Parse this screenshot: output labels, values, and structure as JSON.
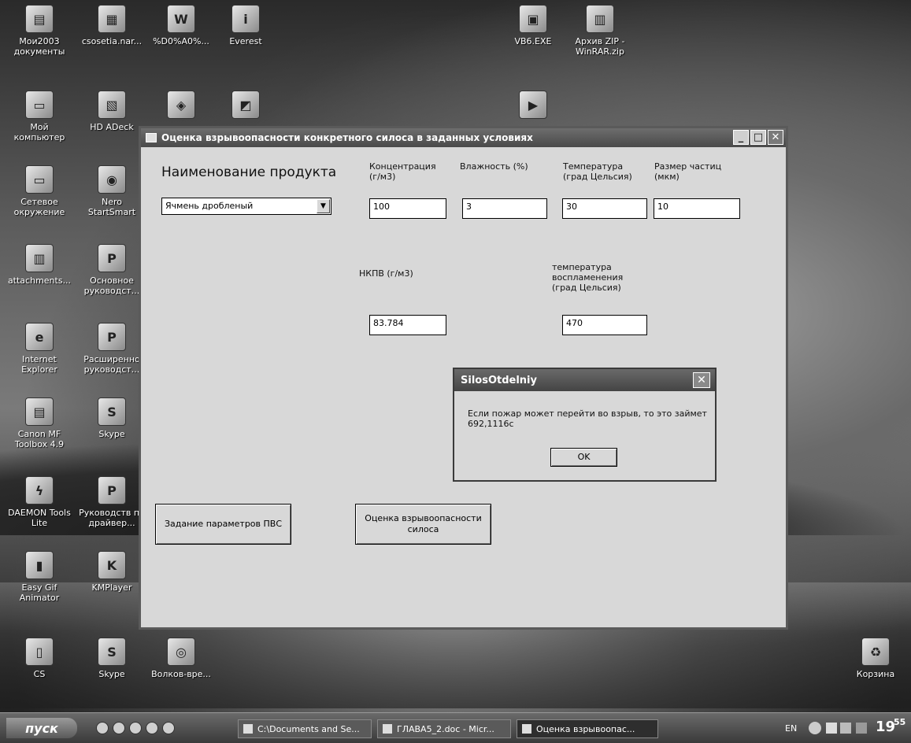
{
  "desktop": {
    "icons": [
      {
        "label": "Мои2003 документы",
        "glyph": "▤"
      },
      {
        "label": "csosetia.nar...",
        "glyph": "▦"
      },
      {
        "label": "%D0%A0%...",
        "glyph": "W"
      },
      {
        "label": "Everest",
        "glyph": "i"
      },
      {
        "label": "VB6.EXE",
        "glyph": "▣"
      },
      {
        "label": "Архив ZIP - WinRAR.zip",
        "glyph": "▥"
      },
      {
        "label": "Мой компьютер",
        "glyph": "▭"
      },
      {
        "label": "HD ADeck",
        "glyph": "▧"
      },
      {
        "label": "",
        "glyph": "◈"
      },
      {
        "label": "",
        "glyph": "◩"
      },
      {
        "label": "",
        "glyph": "▶"
      },
      {
        "label": "Сетевое окружение",
        "glyph": "▭"
      },
      {
        "label": "Nero StartSmart",
        "glyph": "◉"
      },
      {
        "label": "attachments...",
        "glyph": "▥"
      },
      {
        "label": "Основное руководст...",
        "glyph": "P"
      },
      {
        "label": "Internet Explorer",
        "glyph": "e"
      },
      {
        "label": "Расширенно руководст...",
        "glyph": "P"
      },
      {
        "label": "Canon MF Toolbox 4.9",
        "glyph": "▤"
      },
      {
        "label": "Skype",
        "glyph": "S"
      },
      {
        "label": "DAEMON Tools Lite",
        "glyph": "ϟ"
      },
      {
        "label": "Руководств по драйвер...",
        "glyph": "P"
      },
      {
        "label": "Easy Gif Animator",
        "glyph": "▮"
      },
      {
        "label": "KMPlayer",
        "glyph": "K"
      },
      {
        "label": "CS",
        "glyph": "▯"
      },
      {
        "label": "Skype",
        "glyph": "S"
      },
      {
        "label": "Волков-вре...",
        "glyph": "◎"
      },
      {
        "label": "Корзина",
        "glyph": "♻"
      }
    ]
  },
  "window": {
    "title": "Оценка взрывоопасности конкретного силоса в заданных условиях",
    "product_label": "Наименование продукта",
    "product_value": "Ячмень дробленый",
    "conc_label": "Концентрация (г/м3)",
    "conc_value": "100",
    "humidity_label": "Влажность (%)",
    "humidity_value": "3",
    "temp_label": "Температура (град Цельсия)",
    "temp_value": "30",
    "particle_label": "Размер частиц (мкм)",
    "particle_value": "10",
    "nkpv_label": "НКПВ (г/м3)",
    "nkpv_value": "83.784",
    "ignition_label": "температура воспламенения (град Цельсия)",
    "ignition_value": "470",
    "btn_params": "Задание параметров ПВС",
    "btn_assess": "Оценка взрывоопасности силоса"
  },
  "msgbox": {
    "title": "SilosOtdelniy",
    "text": "Если пожар может перейти во взрыв, то это займет 692,1116с",
    "ok": "OK"
  },
  "taskbar": {
    "start": "пуск",
    "tasks": [
      "C:\\Documents and Se...",
      "ГЛАВА5_2.doc - Micr...",
      "Оценка взрывоопас..."
    ],
    "lang": "EN",
    "clock_h": "19",
    "clock_m": "55"
  }
}
